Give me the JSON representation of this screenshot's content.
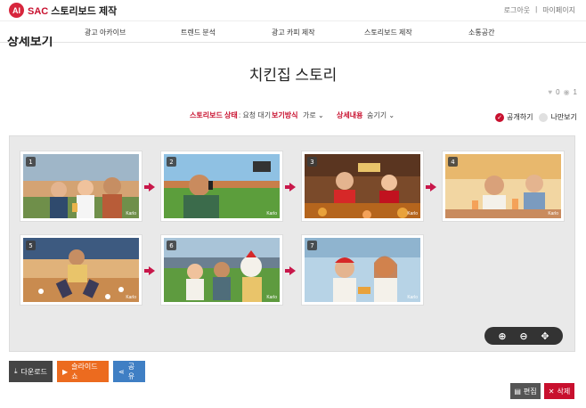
{
  "header": {
    "logo_mark": "AI",
    "logo_brand": "SAC",
    "logo_title": "스토리보드 제작",
    "logout_label": "로그아웃",
    "separator": "|",
    "mypage_label": "마이페이지"
  },
  "nav": {
    "items": [
      "광고 아카이브",
      "트렌드 분석",
      "광고 카피 제작",
      "스토리보드 제작",
      "소통공간"
    ]
  },
  "section_heading": "상세보기",
  "page_title": "치킨집 스토리",
  "counts": {
    "likes": "0",
    "views": "1"
  },
  "meta": {
    "status_label": "스토리보드 상태",
    "status_value": ": 요청 대기",
    "view_label": "보기방식",
    "view_value": "가로",
    "detail_label": "상세내용",
    "detail_value": "숨기기"
  },
  "visibility": {
    "public_label": "공개하기",
    "private_label": "나만보기"
  },
  "frames": [
    {
      "number": "1",
      "watermark": "Karlo",
      "scene": "stadium-fans"
    },
    {
      "number": "2",
      "watermark": "Karlo",
      "scene": "phone-call-baseball-field"
    },
    {
      "number": "3",
      "watermark": "Karlo",
      "scene": "chicken-shop-kitchen"
    },
    {
      "number": "4",
      "watermark": "Karlo",
      "scene": "couple-with-beer"
    },
    {
      "number": "5",
      "watermark": "Karlo",
      "scene": "running-delivery"
    },
    {
      "number": "6",
      "watermark": "Karlo",
      "scene": "stadium-chicken-mascot"
    },
    {
      "number": "7",
      "watermark": "Karlo",
      "scene": "happy-couple-eating"
    }
  ],
  "zoom_controls": {
    "zoom_in": "⊕",
    "zoom_out": "⊖",
    "move": "✥"
  },
  "actions": {
    "download_label": "다운로드",
    "slideshow_label": "슬라이드 쇼",
    "share_label": "공유",
    "edit_label": "편집",
    "delete_label": "삭제"
  },
  "colors": {
    "accent": "#c8102e",
    "slideshow": "#ec6b1f",
    "share": "#3f7fc4"
  }
}
